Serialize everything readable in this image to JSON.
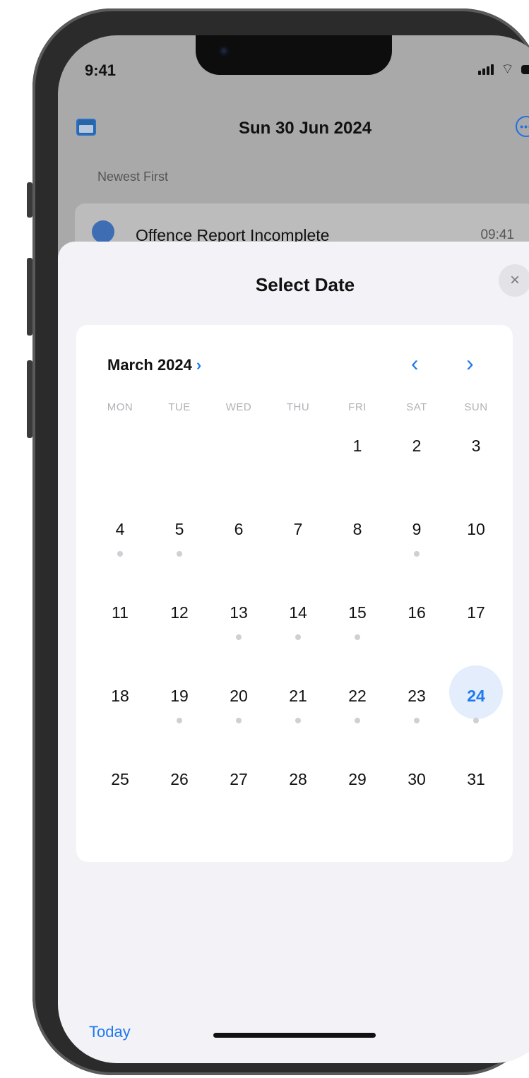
{
  "status": {
    "time": "9:41"
  },
  "navbar": {
    "title": "Sun 30 Jun 2024"
  },
  "list": {
    "sort_label": "Newest First",
    "items": [
      {
        "title": "Offence Report Incomplete",
        "time": "09:41"
      }
    ]
  },
  "sheet": {
    "title": "Select Date",
    "close_symbol": "×",
    "today_label": "Today"
  },
  "calendar": {
    "month_label": "March 2024",
    "weekdays": [
      "MON",
      "TUE",
      "WED",
      "THU",
      "FRI",
      "SAT",
      "SUN"
    ],
    "selected_day": 24,
    "leading_blanks": 4,
    "days": [
      1,
      2,
      3,
      4,
      5,
      6,
      7,
      8,
      9,
      10,
      11,
      12,
      13,
      14,
      15,
      16,
      17,
      18,
      19,
      20,
      21,
      22,
      23,
      24,
      25,
      26,
      27,
      28,
      29,
      30,
      31
    ],
    "dot_days": [
      4,
      5,
      9,
      13,
      14,
      15,
      19,
      20,
      21,
      22,
      23,
      24
    ],
    "prev_symbol": "‹",
    "next_symbol": "›",
    "month_chevron": "›"
  },
  "colors": {
    "accent": "#1f7aee",
    "selected_bg": "#e3edfb",
    "dot": "#cfcfd4"
  },
  "icons": [
    "calendar-icon",
    "ellipsis-circle-icon",
    "close-icon",
    "chevron-left-icon",
    "chevron-right-icon",
    "user-icon"
  ]
}
